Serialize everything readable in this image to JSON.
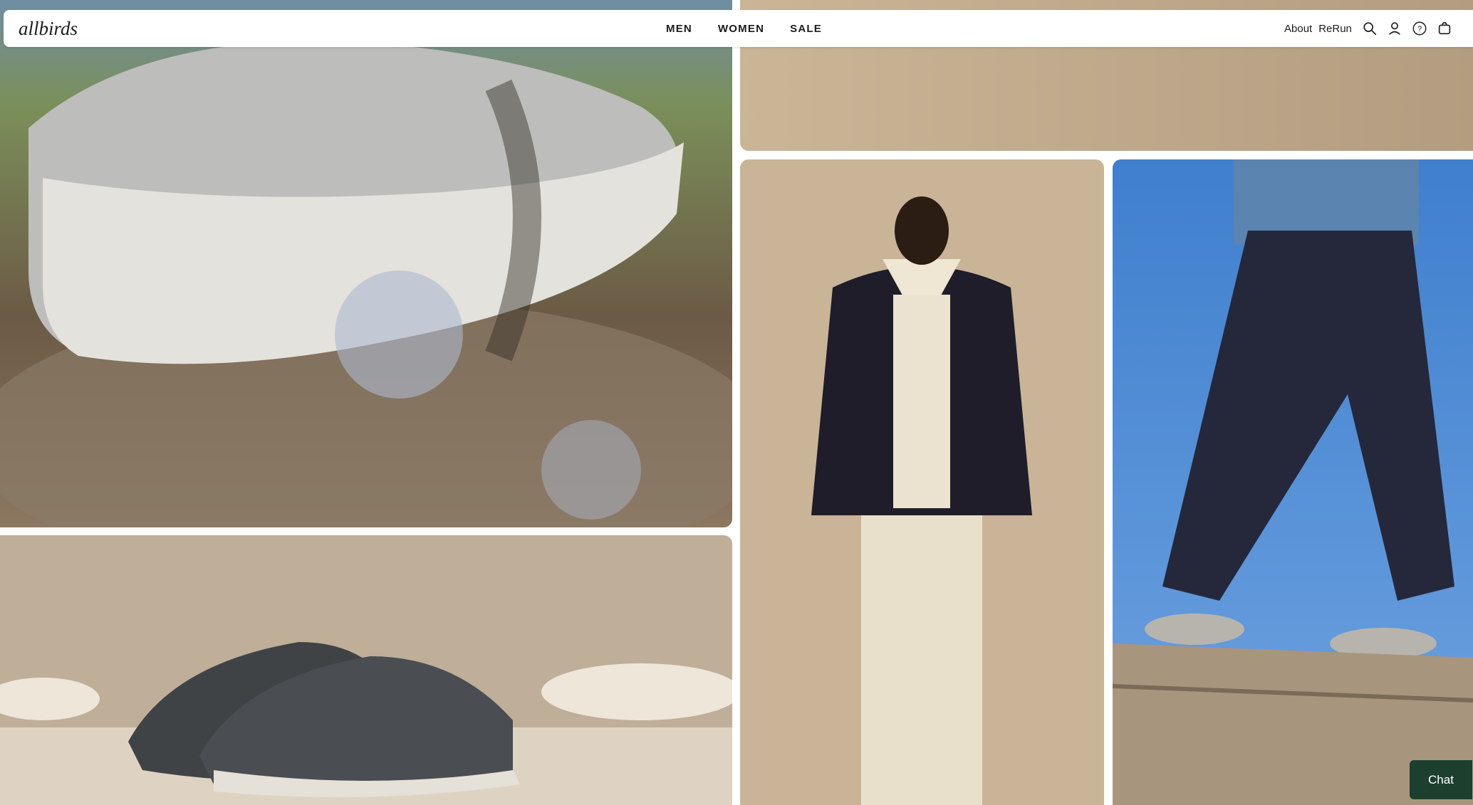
{
  "brand": {
    "logo_text": "allbirds"
  },
  "nav": {
    "main": [
      {
        "label": "MEN"
      },
      {
        "label": "WOMEN"
      },
      {
        "label": "SALE"
      }
    ],
    "secondary": [
      {
        "label": "About"
      },
      {
        "label": "ReRun"
      }
    ],
    "icons": [
      "search-icon",
      "account-icon",
      "help-icon",
      "cart-icon"
    ]
  },
  "chat": {
    "label": "Chat"
  },
  "colors": {
    "chat_bg": "#1d3f2e",
    "header_bg": "#ffffff",
    "text": "#1c1c1c",
    "tan_backdrop": "#c8b294"
  }
}
